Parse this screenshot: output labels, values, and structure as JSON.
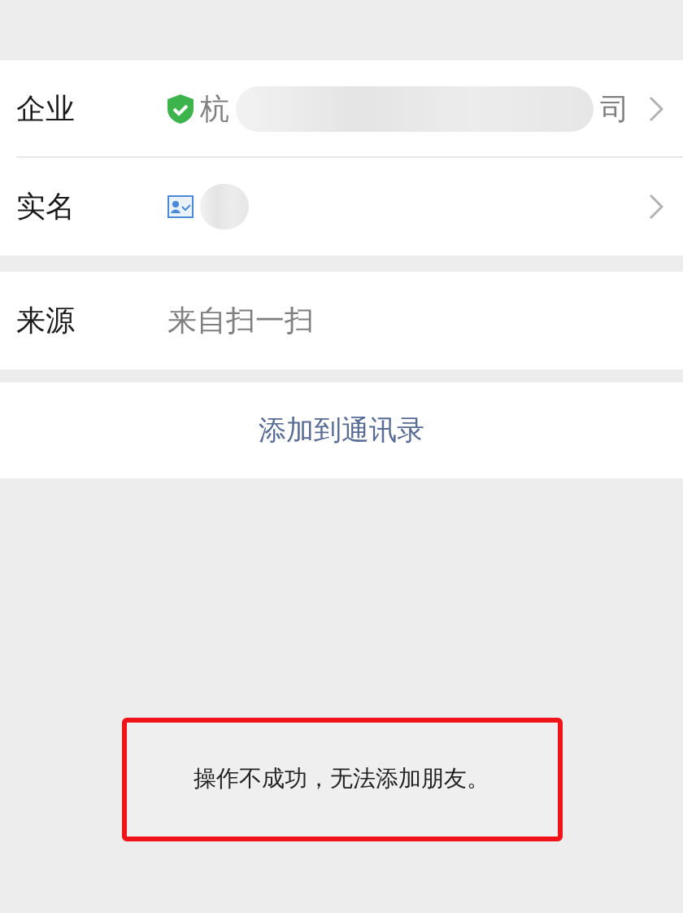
{
  "rows": [
    {
      "kind": "link",
      "label": "企业",
      "verified": true,
      "value_start": "杭",
      "value_end": "司",
      "redacted": true
    },
    {
      "kind": "link",
      "label": "实名",
      "id_card": true,
      "redacted": true
    },
    {
      "kind": "plain",
      "label": "来源",
      "value_start": "来自扫一扫"
    }
  ],
  "add_button": "添加到通讯录",
  "toast": {
    "message": "操作不成功，无法添加朋友。",
    "highlighted": true
  }
}
